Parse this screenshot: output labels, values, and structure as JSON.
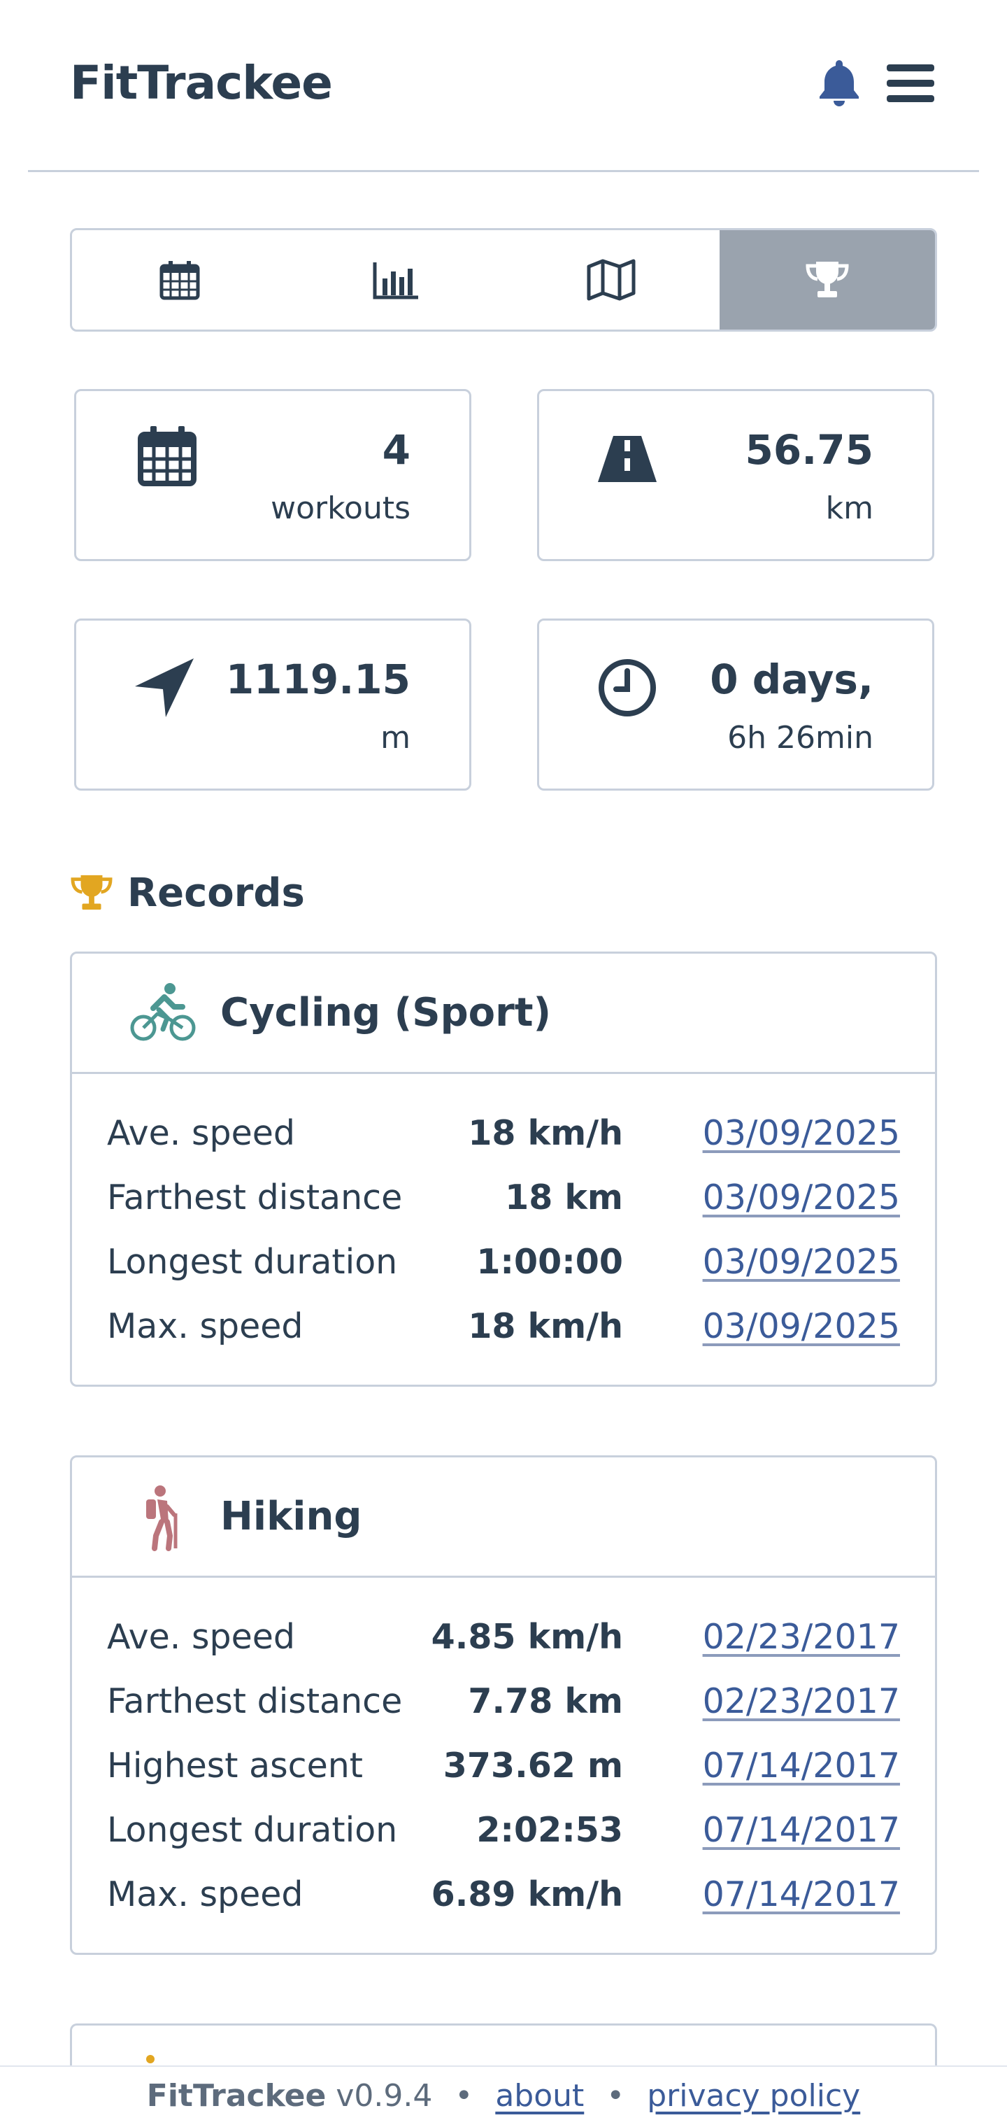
{
  "app": {
    "title": "FitTrackee"
  },
  "nav": {
    "bell_icon": "bell-icon",
    "menu_icon": "hamburger-menu-icon"
  },
  "tabs": [
    {
      "name": "calendar",
      "icon": "calendar-icon",
      "active": false
    },
    {
      "name": "statistics",
      "icon": "bar-chart-icon",
      "active": false
    },
    {
      "name": "map",
      "icon": "map-icon",
      "active": false
    },
    {
      "name": "records",
      "icon": "trophy-icon",
      "active": true
    }
  ],
  "stats": {
    "workouts": {
      "value": "4",
      "unit": "workouts",
      "icon": "calendar-icon"
    },
    "distance": {
      "value": "56.75",
      "unit": "km",
      "icon": "road-icon"
    },
    "ascent": {
      "value": "1119.15",
      "unit": "m",
      "icon": "location-arrow-icon"
    },
    "duration": {
      "value": "0 days,",
      "unit": "6h 26min",
      "icon": "clock-icon"
    }
  },
  "records": {
    "title": "Records",
    "title_icon": "trophy-icon",
    "title_icon_color": "#e2a621",
    "cards": [
      {
        "sport": "Cycling (Sport)",
        "icon": "cycling-icon",
        "color": "#4c9792",
        "rows": [
          {
            "label": "Ave. speed",
            "value": "18 km/h",
            "date": "03/09/2025"
          },
          {
            "label": "Farthest distance",
            "value": "18 km",
            "date": "03/09/2025"
          },
          {
            "label": "Longest duration",
            "value": "1:00:00",
            "date": "03/09/2025"
          },
          {
            "label": "Max. speed",
            "value": "18 km/h",
            "date": "03/09/2025"
          }
        ]
      },
      {
        "sport": "Hiking",
        "icon": "hiking-icon",
        "color": "#bb757c",
        "rows": [
          {
            "label": "Ave. speed",
            "value": "4.85 km/h",
            "date": "02/23/2017"
          },
          {
            "label": "Farthest distance",
            "value": "7.78 km",
            "date": "02/23/2017"
          },
          {
            "label": "Highest ascent",
            "value": "373.62 m",
            "date": "07/14/2017"
          },
          {
            "label": "Longest duration",
            "value": "2:02:53",
            "date": "07/14/2017"
          },
          {
            "label": "Max. speed",
            "value": "6.89 km/h",
            "date": "07/14/2017"
          }
        ]
      }
    ]
  },
  "footer": {
    "brand": "FitTrackee",
    "version": "v0.9.4",
    "separator": "•",
    "about": "about",
    "privacy": "privacy policy"
  },
  "colors": {
    "text": "#2c3e50",
    "border": "#c8d0dc",
    "active_tab": "#9aa3ae",
    "link": "#3b5b99"
  }
}
